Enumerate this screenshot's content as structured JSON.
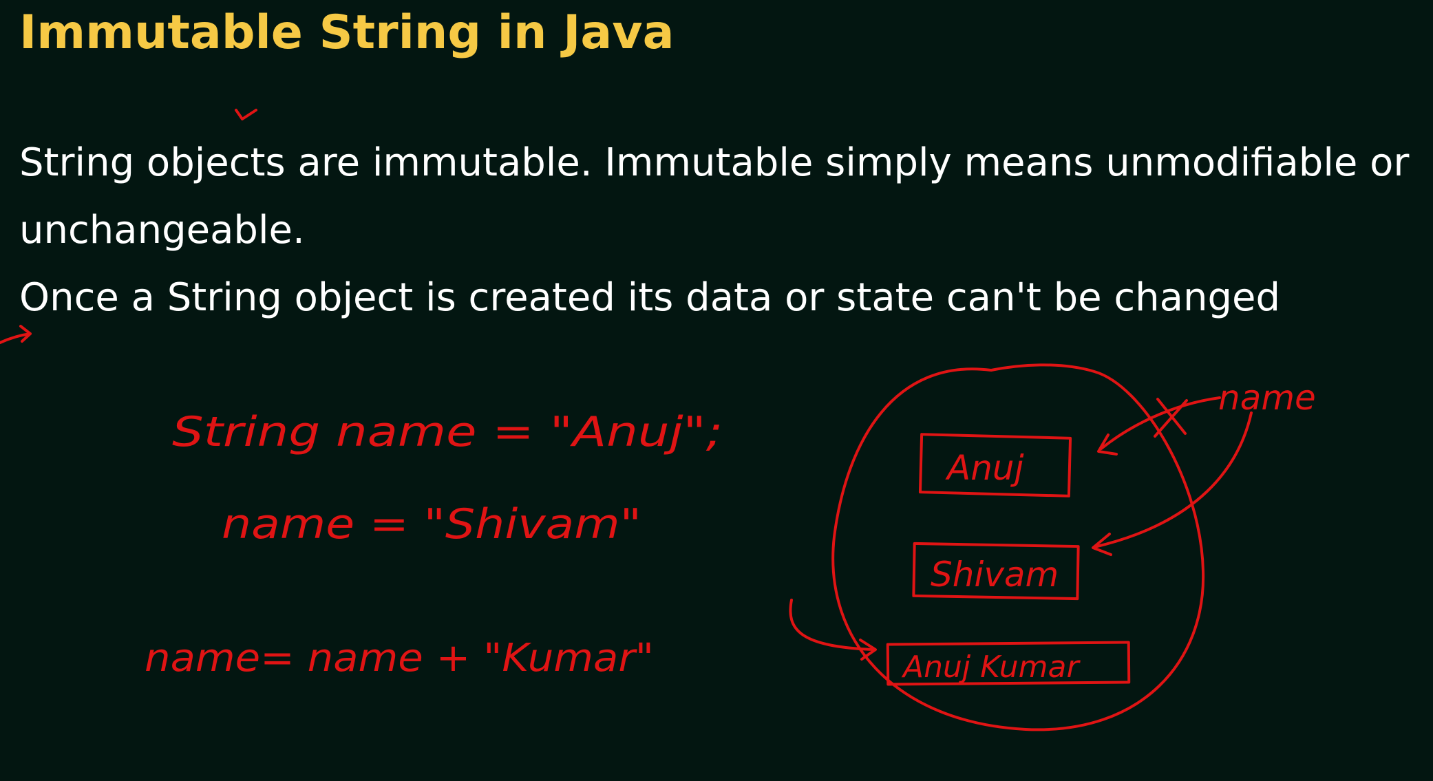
{
  "slide": {
    "title": "Immutable String in Java",
    "paragraphs": [
      "String objects are immutable. Immutable simply means unmodifiable or",
      "unchangeable.",
      "Once a String object is created its data or state can't be changed"
    ]
  },
  "annotations": {
    "ink_color": "#e01414",
    "code_lines": [
      "String name = \"Anuj\";",
      "name = \"Shivam\"",
      "name= name + \"Kumar\""
    ],
    "pool_objects": [
      "Anuj",
      "Shivam",
      "Anuj Kumar"
    ],
    "reference_label": "name"
  },
  "colors": {
    "background": "#031611",
    "title": "#f6c945",
    "body_text": "#ffffff"
  }
}
